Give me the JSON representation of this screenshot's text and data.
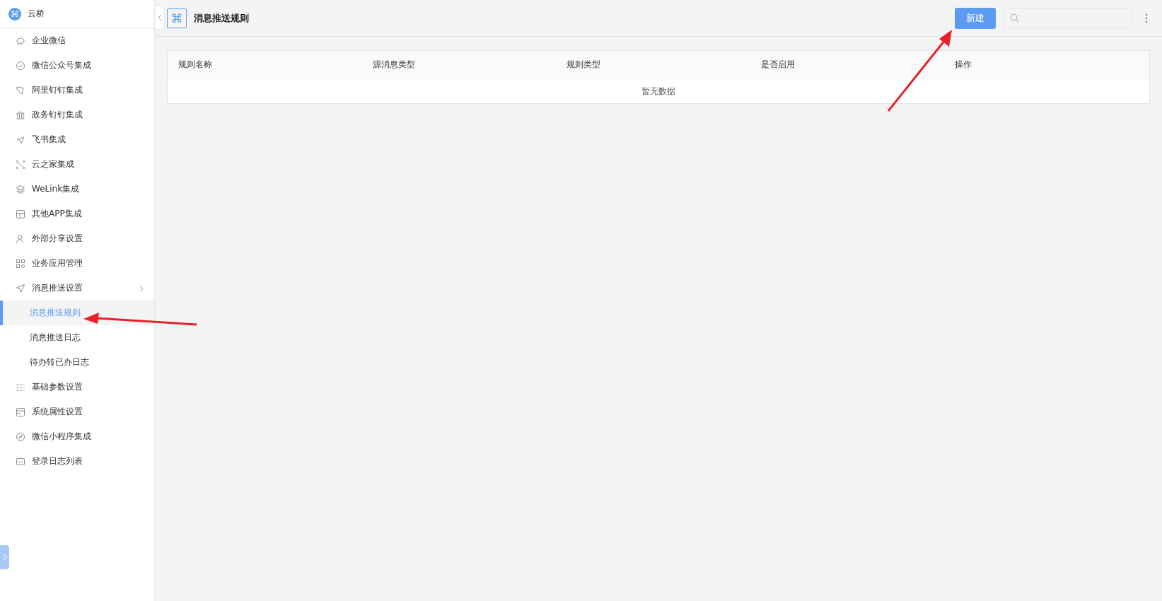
{
  "app": {
    "logo": "⌘",
    "name": "云桥"
  },
  "sidebar": {
    "items": [
      {
        "label": "企业微信",
        "selected": false
      },
      {
        "label": "微信公众号集成",
        "selected": false
      },
      {
        "label": "阿里钉钉集成",
        "selected": false
      },
      {
        "label": "政务钉钉集成",
        "selected": false
      },
      {
        "label": "飞书集成",
        "selected": false
      },
      {
        "label": "云之家集成",
        "selected": false
      },
      {
        "label": "WeLink集成",
        "selected": false
      },
      {
        "label": "其他APP集成",
        "selected": false
      },
      {
        "label": "外部分享设置",
        "selected": false
      },
      {
        "label": "业务应用管理",
        "selected": false
      },
      {
        "label": "消息推送设置",
        "selected": false,
        "expanded": true,
        "children": [
          {
            "label": "消息推送规则",
            "selected": true
          },
          {
            "label": "消息推送日志",
            "selected": false
          },
          {
            "label": "待办转已办日志",
            "selected": false
          }
        ]
      },
      {
        "label": "基础参数设置",
        "selected": false
      },
      {
        "label": "系统属性设置",
        "selected": false
      },
      {
        "label": "微信小程序集成",
        "selected": false
      },
      {
        "label": "登录日志列表",
        "selected": false
      }
    ]
  },
  "header": {
    "icon": "⌘",
    "title": "消息推送规则",
    "new_button": "新建"
  },
  "table": {
    "columns": [
      "规则名称",
      "源消息类型",
      "规则类型",
      "是否启用",
      "操作"
    ],
    "empty_text": "暂无数据"
  }
}
